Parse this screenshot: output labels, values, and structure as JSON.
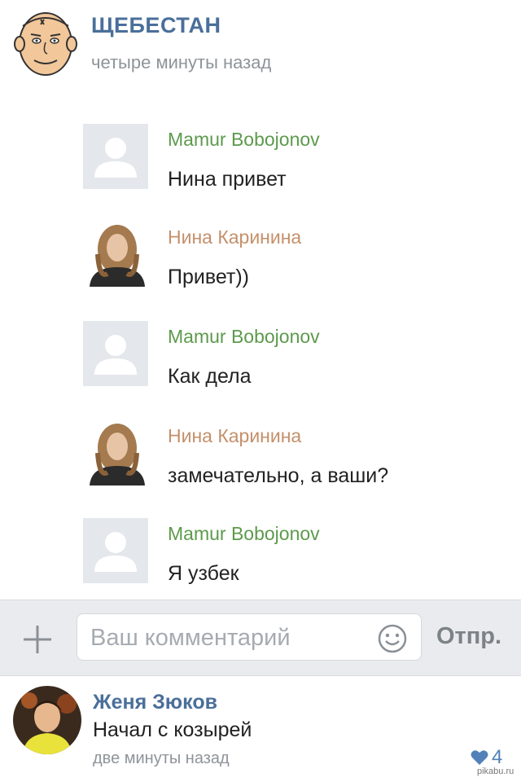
{
  "post": {
    "author_name": "ЩЕБЕСТАН",
    "time": "четыре минуты назад",
    "author_avatar_icon": "cartoon-face-avatar"
  },
  "chat": [
    {
      "sender": "Mamur Bobojonov",
      "text": "Нина привет",
      "sender_color": "#5c9a4c",
      "avatar_icon": "placeholder-user-icon"
    },
    {
      "sender": "Нина Каринина",
      "text": "Привет))",
      "sender_color": "#c4906b",
      "avatar_icon": "photo-avatar"
    },
    {
      "sender": "Mamur Bobojonov",
      "text": "Как дела",
      "sender_color": "#5c9a4c",
      "avatar_icon": "placeholder-user-icon"
    },
    {
      "sender": "Нина Каринина",
      "text": "замечательно, а ваши?",
      "sender_color": "#c4906b",
      "avatar_icon": "photo-avatar"
    },
    {
      "sender": "Mamur Bobojonov",
      "text": "Я узбек",
      "sender_color": "#5c9a4c",
      "avatar_icon": "placeholder-user-icon"
    }
  ],
  "comment_bar": {
    "placeholder": "Ваш комментарий",
    "send_label": "Отпр.",
    "plus_icon": "plus-icon",
    "smile_icon": "smile-icon"
  },
  "comment": {
    "author": "Женя Зюков",
    "text": "Начал с козырей",
    "time": "две минуты назад",
    "likes": "4",
    "heart_color": "#5181b8"
  },
  "watermark": "pikabu.ru",
  "colors": {
    "name_blue": "#4a6f9a",
    "gray_text": "#8e9499"
  }
}
